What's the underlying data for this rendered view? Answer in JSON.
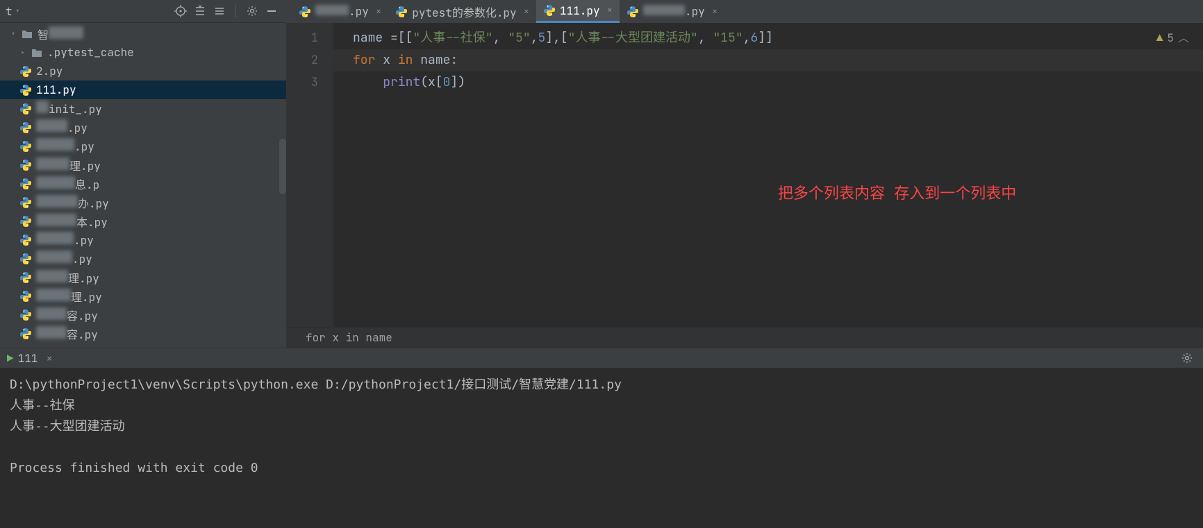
{
  "toolbar": {
    "icons": [
      "target",
      "collapse",
      "show",
      "settings",
      "hide"
    ]
  },
  "project": {
    "root": {
      "label": "",
      "dropdown": true,
      "blurWidth": 50
    },
    "items": [
      {
        "type": "dir",
        "expand": "open",
        "label": ".pytest_cache",
        "indent": 1
      },
      {
        "type": "py",
        "label": "2.py",
        "indent": 1
      },
      {
        "type": "py",
        "label": "111.py",
        "indent": 1,
        "selected": true
      },
      {
        "type": "py",
        "label": "init_.py",
        "indent": 1,
        "blurWidth": 18,
        "prefix": true
      },
      {
        "type": "py",
        "label": ".py",
        "indent": 1,
        "blurWidth": 45
      },
      {
        "type": "py",
        "label": ".py",
        "indent": 1,
        "blurWidth": 55
      },
      {
        "type": "py",
        "label": "理.py",
        "indent": 1,
        "blurWidth": 48
      },
      {
        "type": "py",
        "label": "息.p",
        "indent": 1,
        "blurWidth": 56
      },
      {
        "type": "py",
        "label": "办.py",
        "indent": 1,
        "blurWidth": 60
      },
      {
        "type": "py",
        "label": "本.py",
        "indent": 1,
        "blurWidth": 58
      },
      {
        "type": "py",
        "label": ".py",
        "indent": 1,
        "blurWidth": 54
      },
      {
        "type": "py",
        "label": ".py",
        "indent": 1,
        "blurWidth": 52
      },
      {
        "type": "py",
        "label": "理.py",
        "indent": 1,
        "blurWidth": 46
      },
      {
        "type": "py",
        "label": "理.py",
        "indent": 1,
        "blurWidth": 50
      },
      {
        "type": "py",
        "label": "容.py",
        "indent": 1,
        "blurWidth": 44
      },
      {
        "type": "py",
        "label": "容.py",
        "indent": 1,
        "blurWidth": 44
      }
    ]
  },
  "tabs": [
    {
      "label": ".py",
      "blurWidth": 48,
      "suffix": ".py"
    },
    {
      "label": "pytest的参数化.py"
    },
    {
      "label": "111.py",
      "active": true
    },
    {
      "label": ".py",
      "blurWidth": 60,
      "suffix": ".py"
    }
  ],
  "editor": {
    "gutter": [
      "1",
      "2",
      "3"
    ],
    "code": {
      "l1": {
        "a": "name ",
        "eq": "=[[",
        "s1": "\"人事--社保\"",
        "c1": ", ",
        "s2": "\"5\"",
        "c2": ",",
        "n1": "5",
        "b1": "],[",
        "s3": "\"人事--大型团建活动\"",
        "c3": ", ",
        "s4": "\"15\"",
        "c4": ",",
        "n2": "6",
        "b2": "]]"
      },
      "l2": {
        "kfor": "for ",
        "x": "x ",
        "kin": "in ",
        "name": "name:"
      },
      "l3": {
        "indent": "    ",
        "print": "print",
        "open": "(x[",
        "idx": "0",
        "close": "])"
      }
    },
    "breadcrumb": "for x in name",
    "inspect": {
      "count": "5"
    },
    "annotation": "把多个列表内容 存入到一个列表中"
  },
  "run": {
    "tab": "111",
    "lines": [
      "D:\\pythonProject1\\venv\\Scripts\\python.exe D:/pythonProject1/接口测试/智慧党建/111.py",
      "人事--社保",
      "人事--大型团建活动",
      "",
      "Process finished with exit code 0"
    ]
  }
}
